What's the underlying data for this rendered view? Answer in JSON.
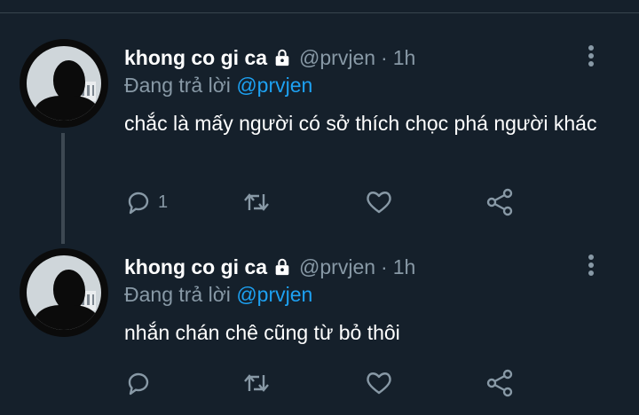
{
  "tweets": [
    {
      "display_name": "khong co gi ca",
      "handle": "@prvjen",
      "separator": "·",
      "time": "1h",
      "reply_prefix": "Đang trả lời",
      "reply_to": "@prvjen",
      "text": "chắc là mấy người có sở thích chọc phá người khác",
      "reply_count": "1"
    },
    {
      "display_name": "khong co gi ca",
      "handle": "@prvjen",
      "separator": "·",
      "time": "1h",
      "reply_prefix": "Đang trả lời",
      "reply_to": "@prvjen",
      "text": "nhắn chán chê cũng từ bỏ thôi",
      "reply_count": ""
    }
  ],
  "icons": {
    "lock": "lock-icon",
    "more": "more-vertical-icon",
    "reply": "reply-icon",
    "retweet": "retweet-icon",
    "like": "heart-icon",
    "share": "share-icon"
  },
  "colors": {
    "background": "#15202b",
    "secondary_text": "#8899a6",
    "link": "#1da1f2",
    "divider": "#38444d"
  }
}
